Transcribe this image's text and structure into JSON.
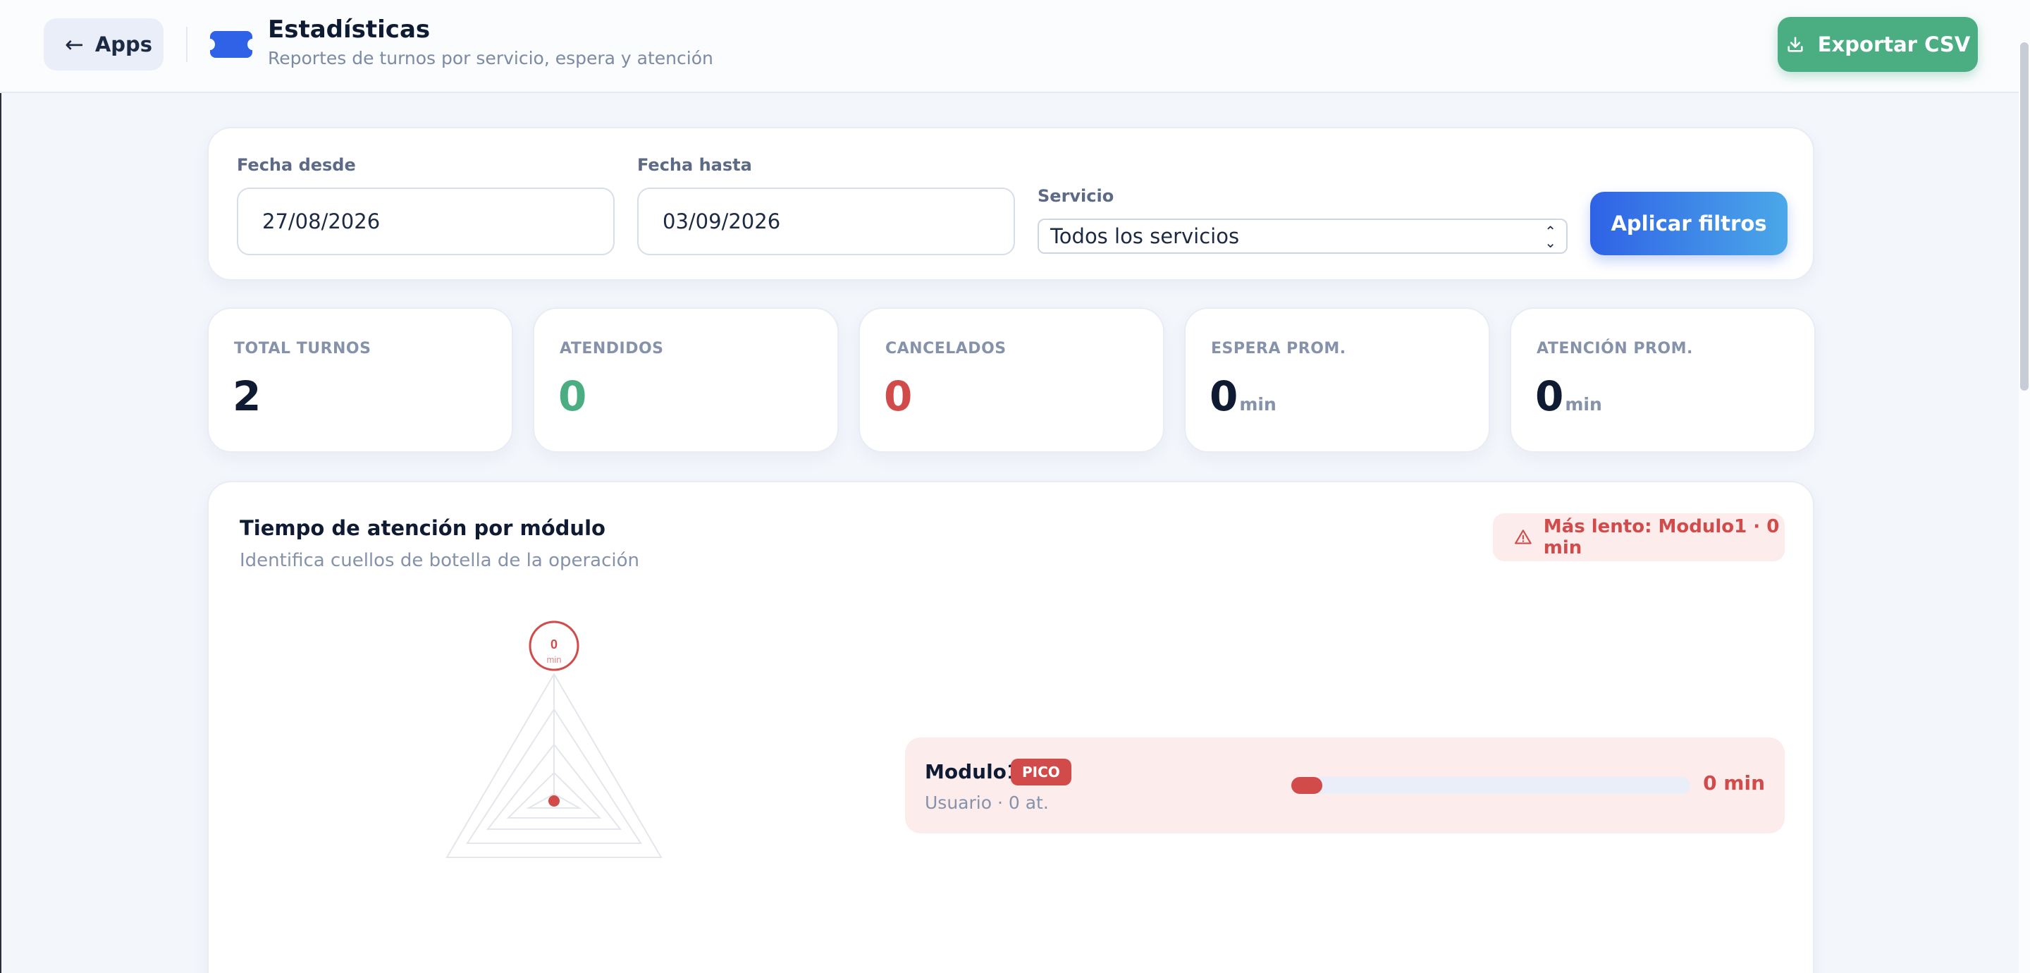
{
  "header": {
    "back_label": "Apps",
    "title": "Estadísticas",
    "subtitle": "Reportes de turnos por servicio, espera y atención",
    "export_label": "Exportar CSV"
  },
  "filters": {
    "from_label": "Fecha desde",
    "from_value": "27/08/2026",
    "to_label": "Fecha hasta",
    "to_value": "03/09/2026",
    "service_label": "Servicio",
    "service_value": "Todos los servicios",
    "apply_label": "Aplicar filtros"
  },
  "stats": [
    {
      "label": "TOTAL TURNOS",
      "value": "2",
      "unit": "",
      "color": "#0f1b33"
    },
    {
      "label": "ATENDIDOS",
      "value": "0",
      "unit": "",
      "color": "#4bae83"
    },
    {
      "label": "CANCELADOS",
      "value": "0",
      "unit": "",
      "color": "#d24b4b"
    },
    {
      "label": "ESPERA PROM.",
      "value": "0",
      "unit": "min",
      "color": "#0f1b33"
    },
    {
      "label": "ATENCIÓN PROM.",
      "value": "0",
      "unit": "min",
      "color": "#0f1b33"
    }
  ],
  "module_section": {
    "title": "Tiempo de atención por módulo",
    "subtitle": "Identifica cuellos de botella de la operación",
    "slowest_label": "Más lento: Modulo1 · 0 min",
    "radar_value": "0",
    "radar_unit": "min",
    "modules": [
      {
        "name": "Modulo1",
        "badge": "PICO",
        "meta": "Usuario · 0 at.",
        "value_label": "0 min",
        "fill_fraction": 0
      }
    ]
  },
  "colors": {
    "primary": "#2f62e6",
    "success": "#4bae83",
    "danger": "#d24b4b"
  },
  "icons": [
    "arrow-left-icon",
    "ticket-icon",
    "download-icon",
    "warning-icon",
    "chevron-updown-icon"
  ]
}
